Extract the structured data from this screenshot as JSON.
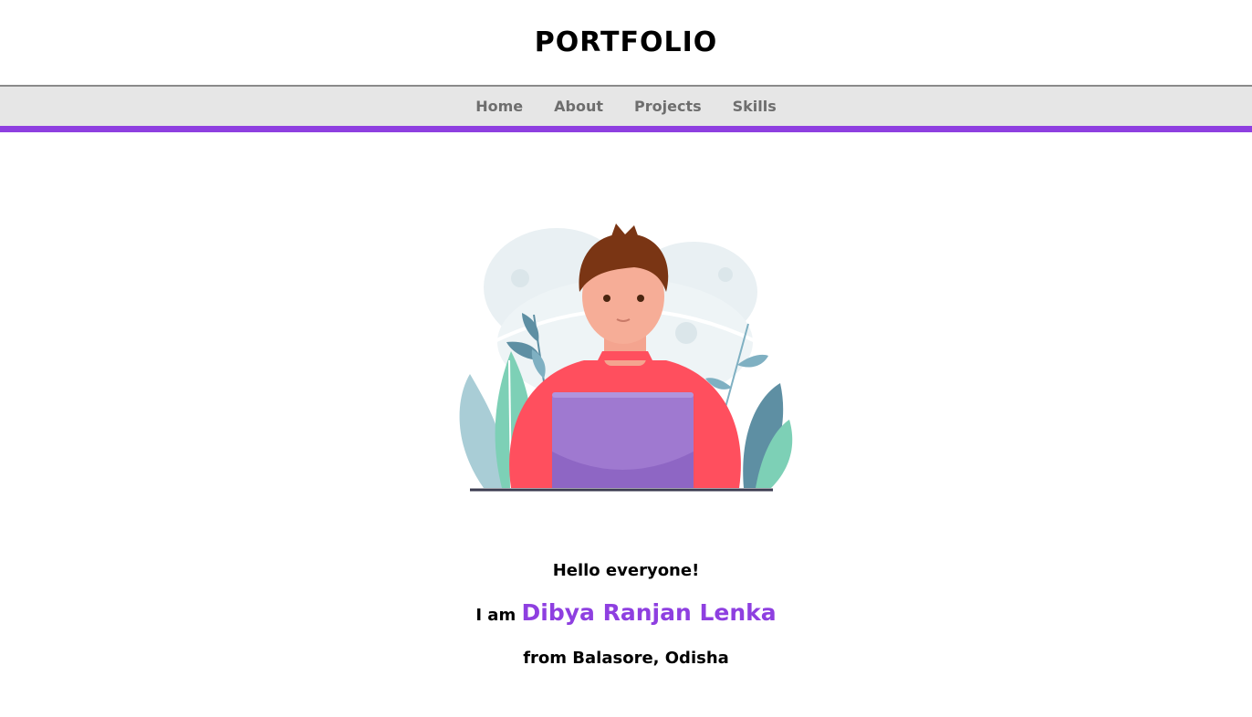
{
  "header": {
    "title": "PORTFOLIO"
  },
  "nav": {
    "items": [
      {
        "label": "Home"
      },
      {
        "label": "About"
      },
      {
        "label": "Projects"
      },
      {
        "label": "Skills"
      }
    ]
  },
  "intro": {
    "greeting": "Hello everyone!",
    "prefix": "I am",
    "name": "Dibya Ranjan Lenka",
    "location": "from Balasore, Odisha"
  },
  "colors": {
    "accent": "#8e3fe0",
    "nav_background": "#e6e6e6",
    "nav_text": "#6e6e6e",
    "sweater": "#ff4f5e",
    "laptop": "#9f79d0"
  }
}
